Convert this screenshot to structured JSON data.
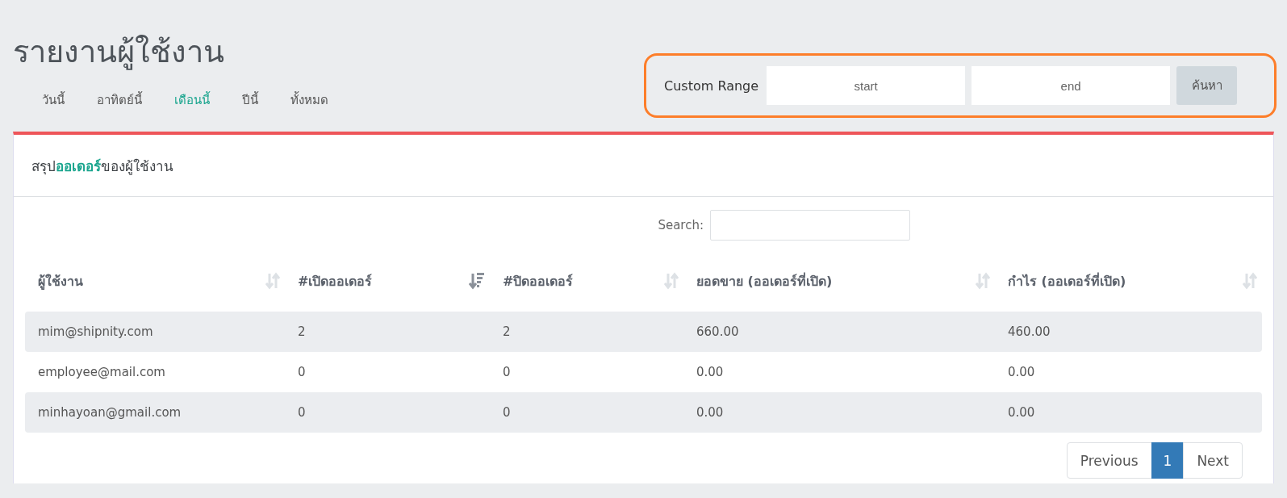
{
  "page_title": "รายงานผู้ใช้งาน",
  "period_tabs": [
    {
      "label": "วันนี้",
      "selected": false
    },
    {
      "label": "อาทิตย์นี้",
      "selected": false
    },
    {
      "label": "เดือนนี้",
      "selected": true
    },
    {
      "label": "ปีนี้",
      "selected": false
    },
    {
      "label": "ทั้งหมด",
      "selected": false
    }
  ],
  "custom_range": {
    "label": "Custom Range",
    "start": {
      "placeholder": "start"
    },
    "end": {
      "placeholder": "end"
    },
    "button": "ค้นหา"
  },
  "card": {
    "title": "สรุป**ออเดอร์**ของผู้ใช้งาน"
  },
  "search": {
    "label": "Search:"
  },
  "table": {
    "columns": [
      {
        "label": "ผู้ใช้งาน",
        "kind": "sortable"
      },
      {
        "label": "#เปิดออเดอร์",
        "kind": "sorted"
      },
      {
        "label": "#ปิดออเดอร์",
        "kind": "sortable"
      },
      {
        "label": "ยอดขาย (ออเดอร์ที่เปิด)",
        "kind": "sortable"
      },
      {
        "label": "กำไร (ออเดอร์ที่เปิด)",
        "kind": "sortable"
      }
    ],
    "rows": [
      [
        "mim@shipnity.com",
        "2",
        "2",
        "660.00",
        "460.00"
      ],
      [
        "employee@mail.com",
        "0",
        "0",
        "0.00",
        "0.00"
      ],
      [
        "minhayoan@gmail.com",
        "0",
        "0",
        "0.00",
        "0.00"
      ]
    ]
  },
  "pagination": [
    {
      "label": "Previous",
      "selected": false
    },
    {
      "label": "1",
      "selected": true
    },
    {
      "label": "Next",
      "selected": false
    }
  ]
}
